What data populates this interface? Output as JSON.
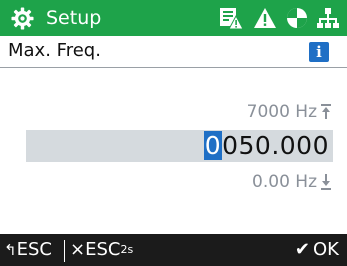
{
  "header": {
    "title": "Setup",
    "icons": [
      "gear-icon",
      "parameter-warning-icon",
      "warning-icon",
      "circle-quadrant-icon",
      "network-icon"
    ]
  },
  "subheader": {
    "label": "Max. Freq.",
    "info_icon": "i"
  },
  "editor": {
    "max_label": "7000 Hz",
    "value_cursor_digit": "0",
    "value_rest": "050.000",
    "min_label": "0.00 Hz"
  },
  "footer": {
    "back_label": "ESC",
    "back_symbol": "↰",
    "esc_long_label": "ESC",
    "esc_long_sub": "2s",
    "esc_long_symbol": "×",
    "ok_label": "OK",
    "ok_symbol": "✔"
  },
  "colors": {
    "header_bg": "#1ea34a",
    "footer_bg": "#1b1b1b",
    "accent_blue": "#1f6fc5",
    "value_bar": "#d5dade"
  }
}
